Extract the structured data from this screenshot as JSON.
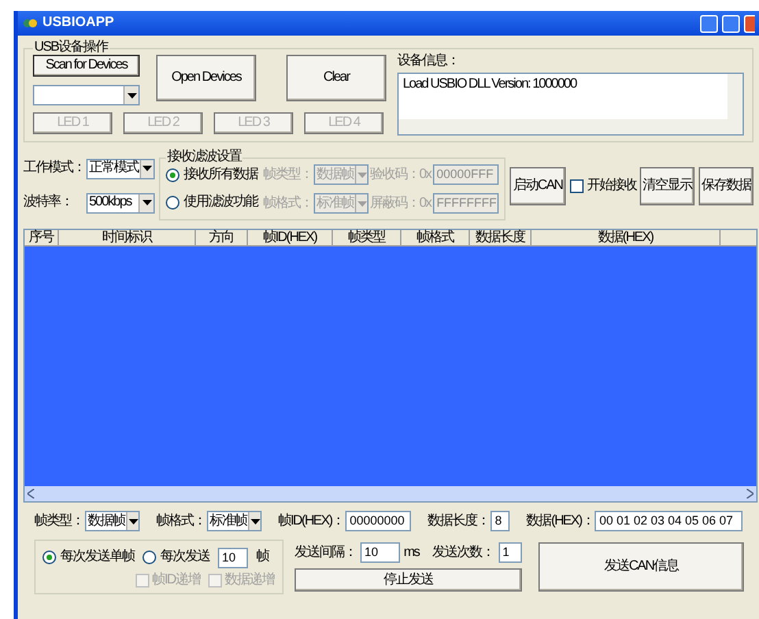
{
  "window": {
    "title": "USBIOAPP"
  },
  "usb_group": {
    "title": "USB设备操作",
    "scan_button": "Scan for Devices",
    "open_button": "Open Devices",
    "clear_button": "Clear",
    "led_buttons": [
      {
        "label": "LED 1",
        "disabled": true
      },
      {
        "label": "LED 2",
        "disabled": true
      },
      {
        "label": "LED 3",
        "disabled": true
      },
      {
        "label": "LED 4",
        "disabled": true
      }
    ],
    "info_label": "设备信息：",
    "info_text": "Load USBIO DLL Version: 1000000"
  },
  "settings": {
    "mode_label": "工作模式：",
    "mode_value": "正常模式",
    "baud_label": "波特率：",
    "baud_value": "500kbps"
  },
  "filter_group": {
    "title": "接收滤波设置",
    "options": [
      {
        "label": "接收所有数据",
        "selected": true
      },
      {
        "label": "使用滤波功能",
        "selected": false
      }
    ],
    "fields": [
      {
        "kind": "combo",
        "label": "帧类型：",
        "value": "数据帧",
        "disabled": true
      },
      {
        "kind": "input",
        "label": "验收码：0x",
        "value": "00000FFF",
        "disabled": true
      },
      {
        "kind": "combo",
        "label": "帧格式：",
        "value": "标准帧",
        "disabled": true
      },
      {
        "kind": "input",
        "label": "屏蔽码：0x",
        "value": "FFFFFFFF",
        "disabled": true
      }
    ]
  },
  "actions": {
    "start_button": "启动CAN",
    "receive_check": {
      "label": "开始接收",
      "checked": false
    },
    "clear_display_button": "清空显示",
    "save_button": "保存数据"
  },
  "table": {
    "columns": [
      "序号",
      "时间标识",
      "方向",
      "帧ID(HEX)",
      "帧类型",
      "帧格式",
      "数据长度",
      "数据(HEX)"
    ]
  },
  "send": {
    "fields": [
      {
        "kind": "combo",
        "label": "帧类型：",
        "value": "数据帧"
      },
      {
        "kind": "combo",
        "label": "帧格式：",
        "value": "标准帧"
      },
      {
        "kind": "input",
        "label": "帧ID(HEX)：",
        "value": "00000000"
      },
      {
        "kind": "input",
        "label": "数据长度：",
        "value": "8"
      },
      {
        "kind": "input",
        "label": "数据(HEX)：",
        "value": "00 01 02 03 04 05 06 07"
      }
    ],
    "mode_options": [
      {
        "label": "每次发送单帧",
        "selected": true
      },
      {
        "label": "每次发送",
        "selected": false
      }
    ],
    "frame_count": "10",
    "frame_unit": "帧",
    "increments": [
      {
        "label": "帧ID递增",
        "checked": false,
        "disabled": true
      },
      {
        "label": "数据递增",
        "checked": false,
        "disabled": true
      }
    ],
    "interval_label": "发送间隔：",
    "interval_value": "10",
    "interval_unit": "ms",
    "count_label": "发送次数：",
    "count_value": "1",
    "stop_button": "停止发送",
    "send_button": "发送CAN信息"
  }
}
